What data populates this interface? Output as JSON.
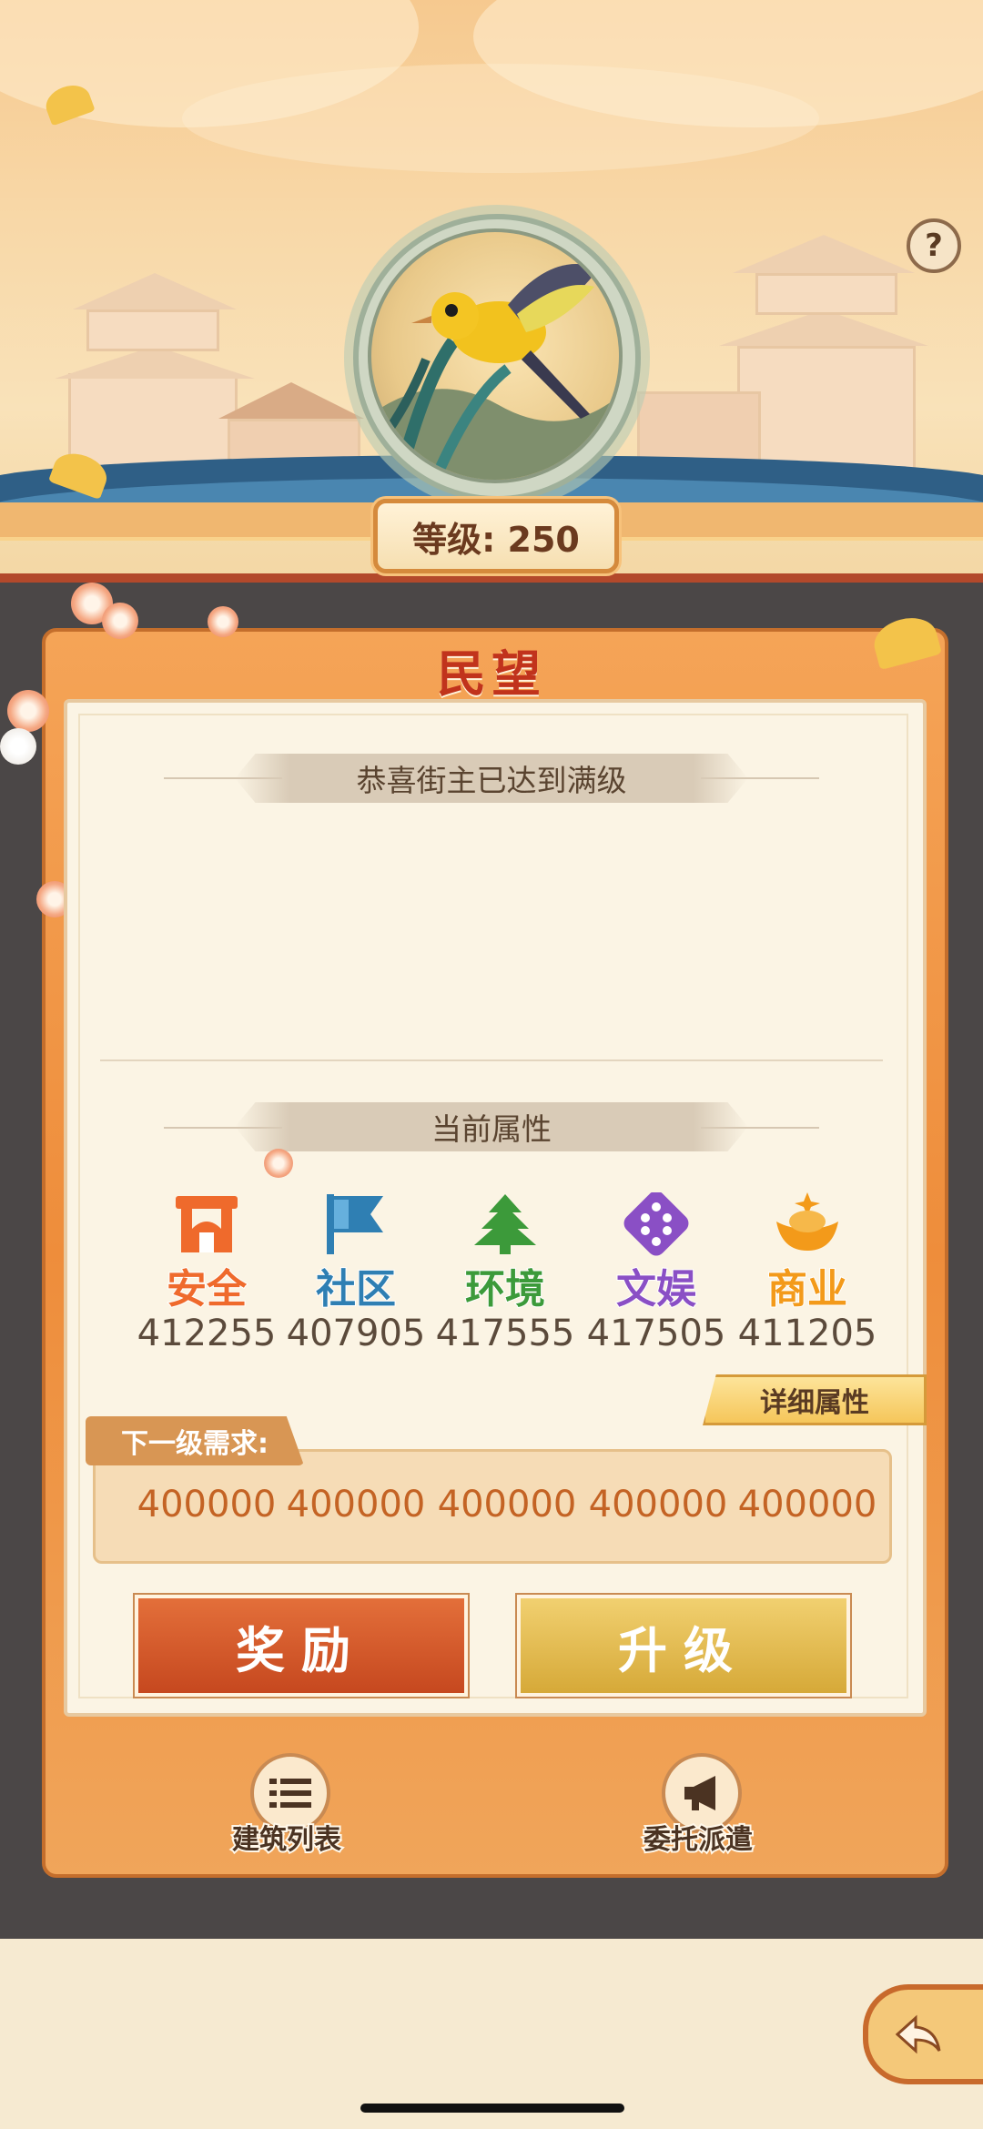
{
  "header": {
    "help_symbol": "?",
    "level_label": "等级: 250",
    "avatar_icon": "oriole-bird-icon"
  },
  "panel": {
    "title": "民望",
    "max_level_message": "恭喜街主已达到满级",
    "current_attributes_title": "当前属性",
    "attributes": [
      {
        "name": "安全",
        "value": "412255",
        "color": "#ef6a2c",
        "icon": "gate-icon"
      },
      {
        "name": "社区",
        "value": "407905",
        "color": "#2f7fb3",
        "icon": "flag-icon"
      },
      {
        "name": "环境",
        "value": "417555",
        "color": "#3c9a3a",
        "icon": "tree-icon"
      },
      {
        "name": "文娱",
        "value": "417505",
        "color": "#8a4fc5",
        "icon": "dice-icon"
      },
      {
        "name": "商业",
        "value": "411205",
        "color": "#f39a1a",
        "icon": "ingot-icon"
      }
    ],
    "detail_button": "详细属性",
    "next_level_label": "下一级需求:",
    "requirements": [
      "400000",
      "400000",
      "400000",
      "400000",
      "400000"
    ],
    "reward_button": "奖励",
    "upgrade_button": "升级"
  },
  "nav": {
    "building_list": "建筑列表",
    "dispatch": "委托派遣"
  },
  "back_icon": "back-arrow-icon"
}
